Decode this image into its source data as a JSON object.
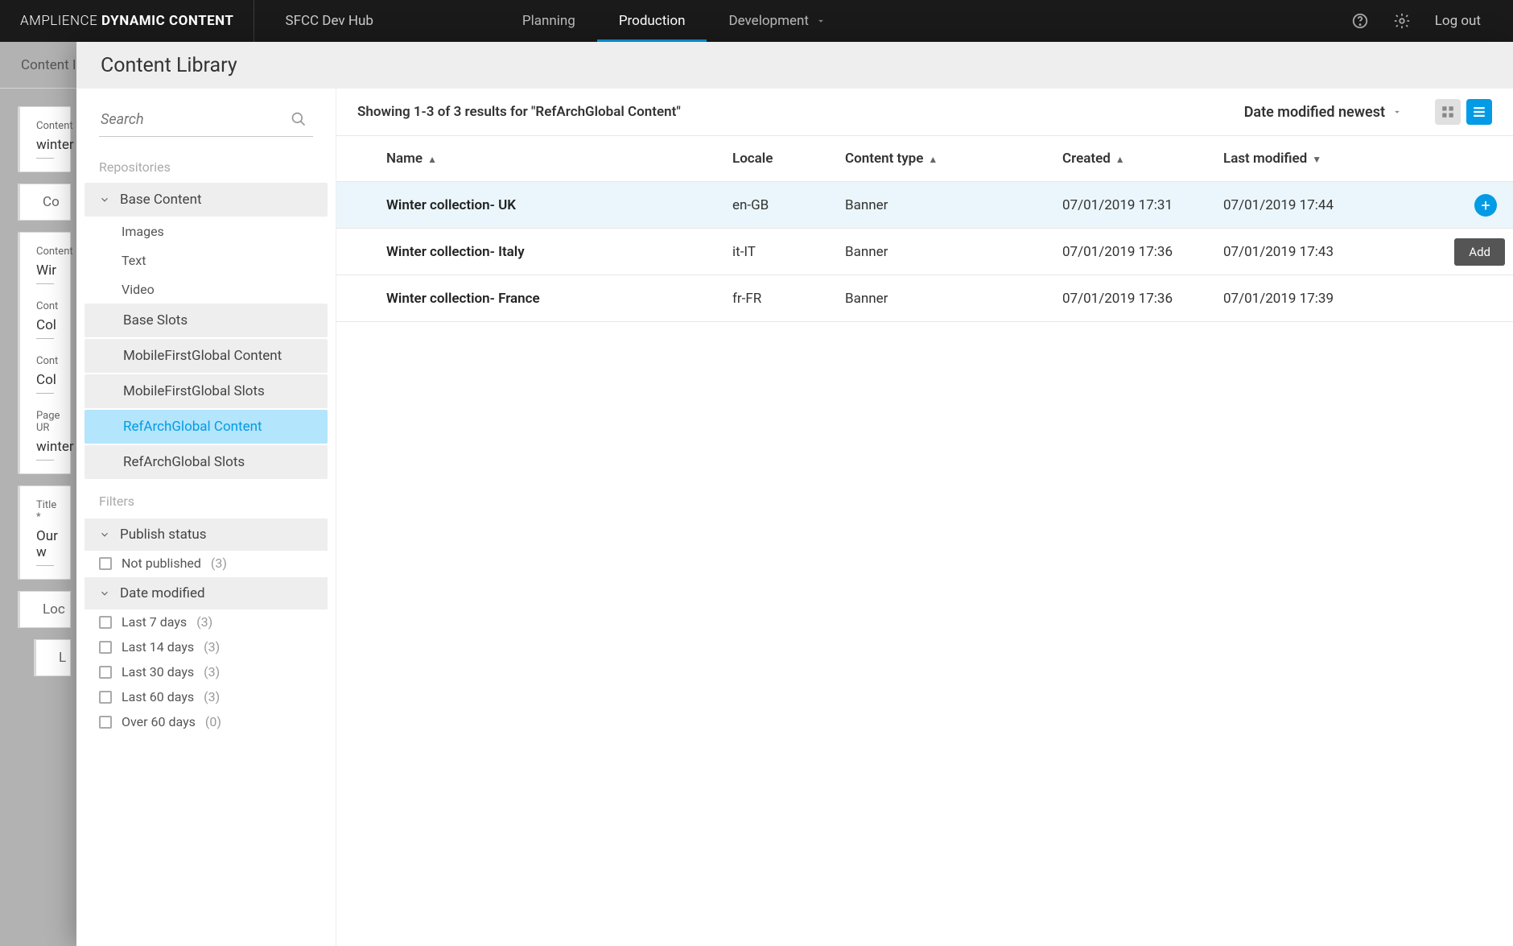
{
  "brand": {
    "light": "AMPLIENCE",
    "bold": " DYNAMIC CONTENT"
  },
  "hub": "SFCC Dev Hub",
  "nav": {
    "items": [
      "Planning",
      "Production",
      "Development"
    ],
    "active": 1
  },
  "logout": "Log out",
  "under": {
    "header": "Content I",
    "card1": {
      "lbl": "Content",
      "val": "winter"
    },
    "sect1": "Co",
    "card2a": {
      "lbl": "Content",
      "val": "Wir"
    },
    "card2b": {
      "lbl": "Cont",
      "val": "Col"
    },
    "card2c": {
      "lbl": "Cont",
      "val": "Col"
    },
    "pageurl": {
      "lbl": "Page UR",
      "val": "winter"
    },
    "title": {
      "lbl": "Title *",
      "val": "Our w"
    },
    "sect2": "Loc",
    "sect3": "L"
  },
  "library": {
    "title": "Content Library",
    "search_ph": "Search",
    "group_repos": "Repositories",
    "tree": {
      "base": "Base Content",
      "subs": [
        "Images",
        "Text",
        "Video"
      ],
      "rows": [
        "Base Slots",
        "MobileFirstGlobal Content",
        "MobileFirstGlobal Slots",
        "RefArchGlobal Content",
        "RefArchGlobal Slots"
      ],
      "selected": 3
    },
    "filters_lbl": "Filters",
    "filt_pub": "Publish status",
    "chk_pub": "Not published",
    "cnt_pub": "(3)",
    "filt_date": "Date modified",
    "datechecks": [
      {
        "l": "Last 7 days",
        "c": "(3)"
      },
      {
        "l": "Last 14 days",
        "c": "(3)"
      },
      {
        "l": "Last 30 days",
        "c": "(3)"
      },
      {
        "l": "Last 60 days",
        "c": "(3)"
      },
      {
        "l": "Over 60 days",
        "c": "(0)"
      }
    ],
    "info": "Showing 1-3 of 3 results for \"RefArchGlobal Content\"",
    "sort": "Date modified newest",
    "cols": {
      "name": "Name",
      "locale": "Locale",
      "ctype": "Content type",
      "created": "Created",
      "mod": "Last modified"
    },
    "rows": [
      {
        "name": "Winter collection- UK",
        "locale": "en-GB",
        "ctype": "Banner",
        "created": "07/01/2019 17:31",
        "mod": "07/01/2019 17:44",
        "hov": true
      },
      {
        "name": "Winter collection- Italy",
        "locale": "it-IT",
        "ctype": "Banner",
        "created": "07/01/2019 17:36",
        "mod": "07/01/2019 17:43"
      },
      {
        "name": "Winter collection- France",
        "locale": "fr-FR",
        "ctype": "Banner",
        "created": "07/01/2019 17:36",
        "mod": "07/01/2019 17:39"
      }
    ],
    "add_tip": "Add"
  }
}
